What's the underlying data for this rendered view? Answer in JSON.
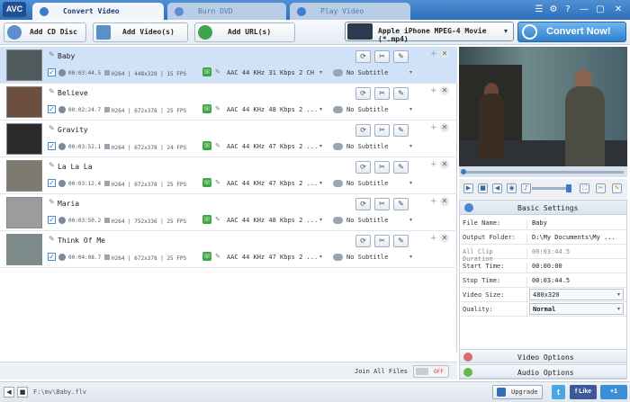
{
  "app": {
    "logo": "AVC"
  },
  "tabs": [
    {
      "label": "Convert Video",
      "icon": "convert-icon"
    },
    {
      "label": "Burn DVD",
      "icon": "disc-icon"
    },
    {
      "label": "Play Video",
      "icon": "play-icon"
    }
  ],
  "window": {
    "menu": "☰",
    "settings": "⚙",
    "help": "?",
    "minimize": "—",
    "maximize": "▢",
    "close": "✕"
  },
  "toolbar": {
    "add_cd": "Add CD Disc",
    "add_video": "Add Video(s)",
    "add_url": "Add URL(s)",
    "profile": "Apple iPhone MPEG-4 Movie (*.mp4)",
    "profile_arrow": "▾",
    "convert": "Convert Now!"
  },
  "files": [
    {
      "name": "Baby",
      "duration": "00:03:44.5",
      "video": "H264 | 448x328 | 15 FPS",
      "audio": "AAC 44 KHz 31 Kbps 2 CH",
      "subtitle": "No Subtitle",
      "selected": true
    },
    {
      "name": "Believe",
      "duration": "00:02:24.7",
      "video": "H264 | 672x378 | 25 FPS",
      "audio": "AAC 44 KHz 48 Kbps 2 ...",
      "subtitle": "No Subtitle",
      "selected": false
    },
    {
      "name": "Gravity",
      "duration": "00:03:52.1",
      "video": "H264 | 672x378 | 24 FPS",
      "audio": "AAC 44 KHz 47 Kbps 2 ...",
      "subtitle": "No Subtitle",
      "selected": false
    },
    {
      "name": "La La La",
      "duration": "00:03:12.4",
      "video": "H264 | 672x378 | 25 FPS",
      "audio": "AAC 44 KHz 47 Kbps 2 ...",
      "subtitle": "No Subtitle",
      "selected": false
    },
    {
      "name": "Maria",
      "duration": "00:03:50.2",
      "video": "H264 | 752x336 | 25 FPS",
      "audio": "AAC 44 KHz 48 Kbps 2 ...",
      "subtitle": "No Subtitle",
      "selected": false
    },
    {
      "name": "Think Of Me",
      "duration": "00:04:08.7",
      "video": "H264 | 672x378 | 25 FPS",
      "audio": "AAC 44 KHz 47 Kbps 2 ...",
      "subtitle": "No Subtitle",
      "selected": false
    }
  ],
  "row_icons": {
    "refresh": "⟳",
    "cut": "✂",
    "effect": "✎",
    "add": "+",
    "remove": "✕",
    "check": "✓",
    "pen": "✎",
    "dropdown": "▾"
  },
  "join": {
    "label": "Join All Files",
    "state": "OFF"
  },
  "player": {
    "play": "▶",
    "stop": "■",
    "prev": "◀",
    "snapshot": "◉",
    "volume": "♪",
    "full": "⛶",
    "crop": "✂",
    "cut": "✂",
    "effect": "✎"
  },
  "basic_settings": {
    "title": "Basic Settings",
    "rows": [
      {
        "key": "File Name:",
        "value": "Baby"
      },
      {
        "key": "Output Folder:",
        "value": "D:\\My Documents\\My ..."
      },
      {
        "key": "All Clip Duration",
        "value": "00:03:44.5"
      },
      {
        "key": "Start Time:",
        "value": "00:00:00"
      },
      {
        "key": "Stop Time:",
        "value": "00:03:44.5"
      },
      {
        "key": "Video Size:",
        "value": "480x320"
      },
      {
        "key": "Quality:",
        "value": "Normal"
      }
    ]
  },
  "video_options": "Video Options",
  "audio_options": "Audio Options",
  "status": {
    "path": "F:\\mv\\Baby.flv",
    "upgrade": "Upgrade",
    "twitter": "t",
    "like": "f Like",
    "gplus": "+1"
  },
  "colors": {
    "accent": "#2f6fb9",
    "convert": "#3d8cd8",
    "selected_row": "#cfe2f7"
  }
}
